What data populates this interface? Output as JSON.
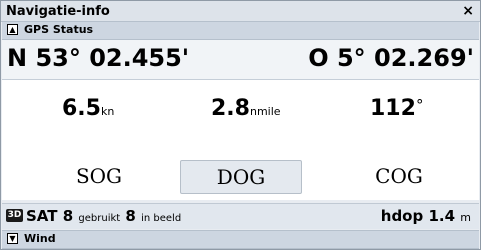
{
  "window": {
    "title": "Navigatie-info",
    "close_glyph": "×"
  },
  "gps_section": {
    "toggle_glyph": "▲",
    "label": "GPS Status",
    "latitude": "N 53° 02.455'",
    "longitude": "O 5° 02.269'",
    "sog": {
      "value": "6.5",
      "unit": "kn",
      "label": "SOG"
    },
    "dog": {
      "value": "2.8",
      "unit": "nmile",
      "label": "DOG"
    },
    "cog": {
      "value": "112",
      "unit": "°",
      "label": "COG"
    },
    "fix_badge": "3D",
    "sat_prefix": "SAT",
    "sat_used": "8",
    "sat_used_label": "gebruikt",
    "sat_visible": "8",
    "sat_visible_label": "in beeld",
    "hdop_label": "hdop",
    "hdop_value": "1.4",
    "hdop_unit": "m"
  },
  "wind_section": {
    "toggle_glyph": "▼",
    "label": "Wind"
  }
}
